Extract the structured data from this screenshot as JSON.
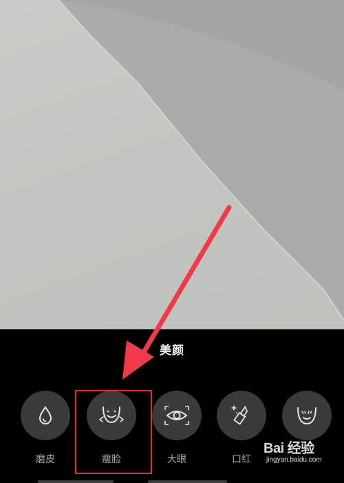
{
  "panel": {
    "title": "美颜"
  },
  "tools": [
    {
      "label": "磨皮",
      "icon": "droplet-icon",
      "selected": false
    },
    {
      "label": "瘦脸",
      "icon": "slim-face-icon",
      "selected": true
    },
    {
      "label": "大眼",
      "icon": "eye-icon",
      "selected": false
    },
    {
      "label": "口红",
      "icon": "lipstick-icon",
      "selected": false
    },
    {
      "label": "",
      "icon": "smile-face-icon",
      "selected": false
    }
  ],
  "watermark": {
    "brand": "Bai 经验",
    "url": "jingyan.baidu.com"
  },
  "colors": {
    "panel_background": "#000000",
    "tool_circle": "#3a3a3a",
    "highlight": "#e62b2b",
    "arrow": "#f03a4a"
  }
}
